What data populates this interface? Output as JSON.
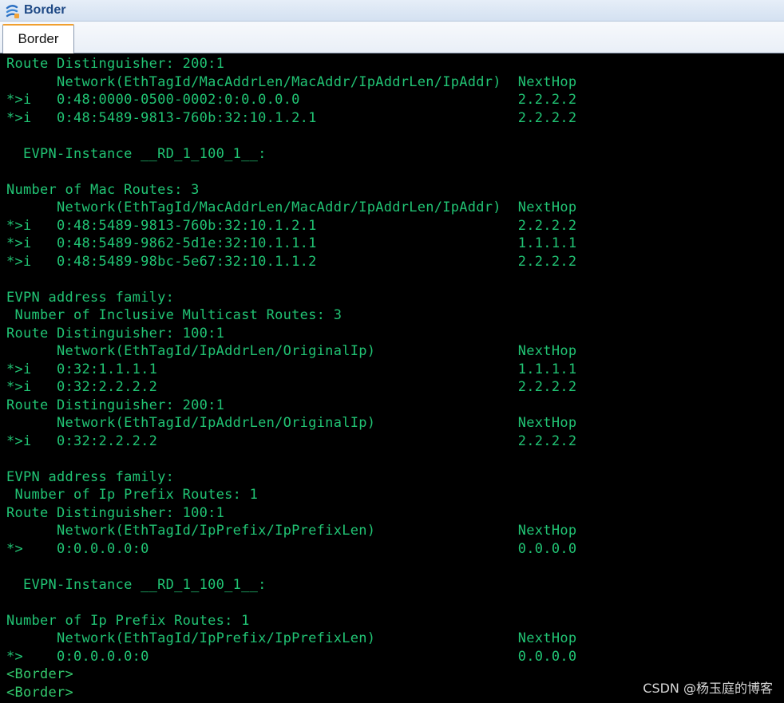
{
  "window": {
    "title": "Border",
    "icon": "network-device-icon"
  },
  "tabs": [
    {
      "label": "Border",
      "active": true
    }
  ],
  "terminal": {
    "text_color": "#21c474",
    "background": "#000000",
    "lines": [
      "Route Distinguisher: 200:1",
      "      Network(EthTagId/MacAddrLen/MacAddr/IpAddrLen/IpAddr)  NextHop",
      "*>i   0:48:0000-0500-0002:0:0.0.0.0                          2.2.2.2",
      "*>i   0:48:5489-9813-760b:32:10.1.2.1                        2.2.2.2",
      "",
      "  EVPN-Instance __RD_1_100_1__:",
      "",
      "Number of Mac Routes: 3",
      "      Network(EthTagId/MacAddrLen/MacAddr/IpAddrLen/IpAddr)  NextHop",
      "*>i   0:48:5489-9813-760b:32:10.1.2.1                        2.2.2.2",
      "*>i   0:48:5489-9862-5d1e:32:10.1.1.1                        1.1.1.1",
      "*>i   0:48:5489-98bc-5e67:32:10.1.1.2                        2.2.2.2",
      "",
      "EVPN address family:",
      " Number of Inclusive Multicast Routes: 3",
      "Route Distinguisher: 100:1",
      "      Network(EthTagId/IpAddrLen/OriginalIp)                 NextHop",
      "*>i   0:32:1.1.1.1                                           1.1.1.1",
      "*>i   0:32:2.2.2.2                                           2.2.2.2",
      "Route Distinguisher: 200:1",
      "      Network(EthTagId/IpAddrLen/OriginalIp)                 NextHop",
      "*>i   0:32:2.2.2.2                                           2.2.2.2",
      "",
      "EVPN address family:",
      " Number of Ip Prefix Routes: 1",
      "Route Distinguisher: 100:1",
      "      Network(EthTagId/IpPrefix/IpPrefixLen)                 NextHop",
      "*>    0:0.0.0.0:0                                            0.0.0.0",
      "",
      "  EVPN-Instance __RD_1_100_1__:",
      "",
      "Number of Ip Prefix Routes: 1",
      "      Network(EthTagId/IpPrefix/IpPrefixLen)                 NextHop",
      "*>    0:0.0.0.0:0                                            0.0.0.0"
    ],
    "prompts": [
      "<Border>",
      "<Border>"
    ]
  },
  "watermark": "CSDN @杨玉庭的博客"
}
